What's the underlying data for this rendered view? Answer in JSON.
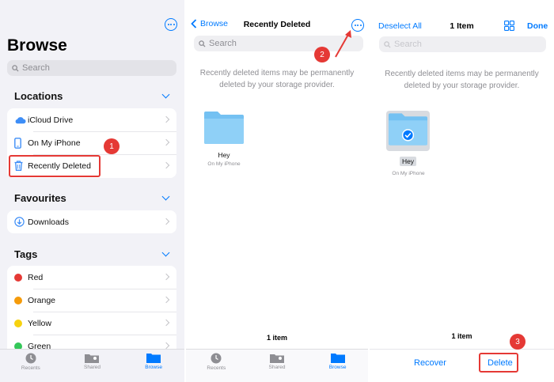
{
  "browse": {
    "title": "Browse",
    "search_placeholder": "Search",
    "sections": {
      "locations": "Locations",
      "favourites": "Favourites",
      "tags": "Tags"
    },
    "locations": [
      {
        "label": "iCloud Drive",
        "icon": "cloud-icon"
      },
      {
        "label": "On My iPhone",
        "icon": "phone-icon"
      },
      {
        "label": "Recently Deleted",
        "icon": "trash-icon"
      }
    ],
    "favourites": [
      {
        "label": "Downloads",
        "icon": "download-icon"
      }
    ],
    "tags": [
      {
        "label": "Red",
        "color": "#e53935"
      },
      {
        "label": "Orange",
        "color": "#f59b0b"
      },
      {
        "label": "Yellow",
        "color": "#f7d20f"
      },
      {
        "label": "Green",
        "color": "#34c759"
      }
    ]
  },
  "tabbar": {
    "recents": "Recents",
    "shared": "Shared",
    "browse": "Browse"
  },
  "recently_deleted": {
    "back_label": "Browse",
    "title": "Recently Deleted",
    "search_placeholder": "Search",
    "info_text_line1": "Recently deleted items may be permanently",
    "info_text_line2": "deleted by your storage provider.",
    "folder_name": "Hey",
    "folder_location": "On My iPhone",
    "item_count": "1 item"
  },
  "select_mode": {
    "deselect_label": "Deselect All",
    "title": "1 Item",
    "done_label": "Done",
    "search_placeholder": "Search",
    "info_text_line1": "Recently deleted items may be permanently",
    "info_text_line2": "deleted by your storage provider.",
    "folder_name": "Hey",
    "folder_location": "On My iPhone",
    "item_count": "1 item",
    "recover_label": "Recover",
    "delete_label": "Delete"
  },
  "callouts": {
    "step1": "1",
    "step2": "2",
    "step3": "3"
  },
  "colors": {
    "accent": "#007aff",
    "highlight": "#e53935",
    "folder": "#74c1f2"
  }
}
